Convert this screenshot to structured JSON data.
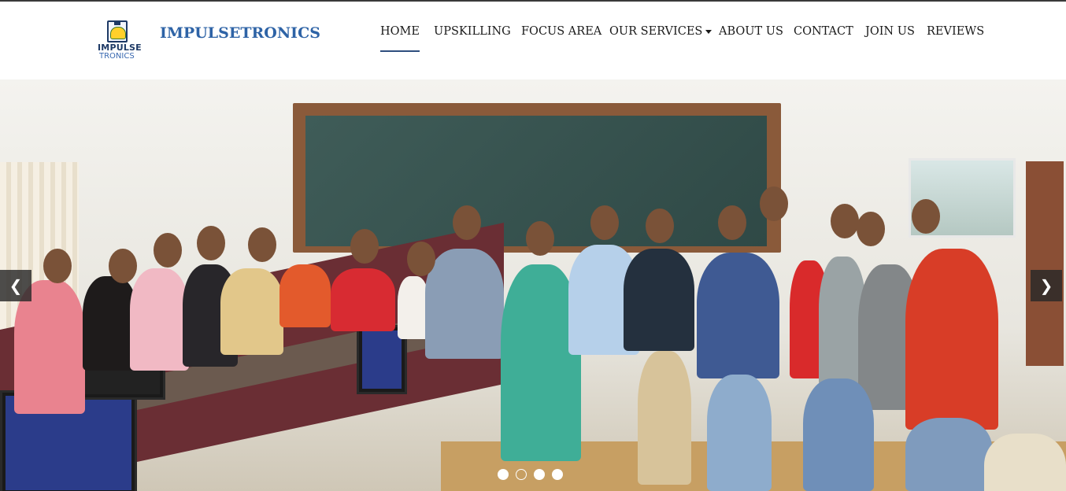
{
  "logo": {
    "line1": "IMPULSE",
    "line2": "TRONICS"
  },
  "brand": "IMPULSETRONICS",
  "nav": {
    "items": [
      {
        "label": "HOME",
        "active": true
      },
      {
        "label": "UPSKILLING"
      },
      {
        "label": "FOCUS AREA"
      },
      {
        "label": "OUR SERVICES",
        "dropdown": true
      },
      {
        "label": "ABOUT US"
      },
      {
        "label": "CONTACT"
      },
      {
        "label": "JOIN US"
      },
      {
        "label": "REVIEWS"
      }
    ]
  },
  "carousel": {
    "prev_glyph": "❮",
    "next_glyph": "❯",
    "slide_count": 4,
    "active_slide": 1
  },
  "colors": {
    "brand": "#2e63a6",
    "nav_active_underline": "#2e4e7e",
    "text": "#1a1a1a"
  }
}
